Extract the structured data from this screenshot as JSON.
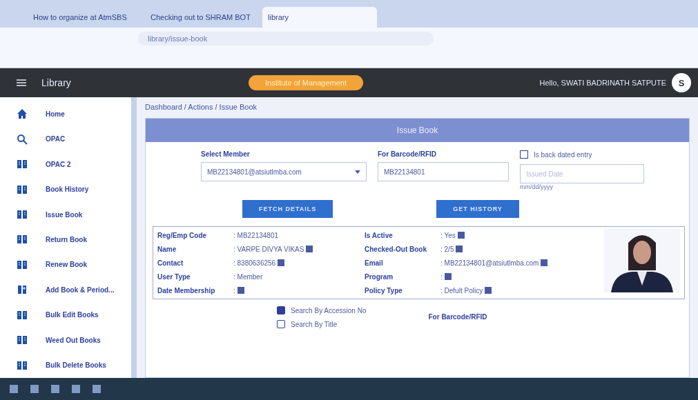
{
  "browser": {
    "tabs": [
      {
        "title": "How to organize at AtmSBS",
        "selected": false
      },
      {
        "title": "Checking out to SHRAM BOT",
        "selected": false
      },
      {
        "title": "library",
        "selected": true
      }
    ],
    "address": "library/issue-book"
  },
  "header": {
    "title": "Library",
    "pill": "Institute of Management",
    "greeting": "Hello, SWATI BADRINATH SATPUTE",
    "avatar": "S"
  },
  "sidebar": {
    "items": [
      {
        "label": "Home",
        "kind": "home"
      },
      {
        "label": "OPAC",
        "kind": "search"
      },
      {
        "label": "OPAC 2",
        "kind": "book"
      },
      {
        "label": "Book History",
        "kind": "book"
      },
      {
        "label": "Issue Book",
        "kind": "book"
      },
      {
        "label": "Return Book",
        "kind": "book"
      },
      {
        "label": "Renew Book",
        "kind": "book"
      },
      {
        "label": "Add Book & Period...",
        "kind": "add"
      },
      {
        "label": "Bulk Edit Books",
        "kind": "book"
      },
      {
        "label": "Weed Out Books",
        "kind": "book"
      },
      {
        "label": "Bulk Delete Books",
        "kind": "book"
      }
    ]
  },
  "breadcrumb": "Dashboard / Actions / Issue Book",
  "card": {
    "title": "Issue Book",
    "member": {
      "label": "Select Member",
      "value": "MB22134801@atsiutlmba.com"
    },
    "barcode": {
      "label": "For Barcode/RFID",
      "value": "MB22134801"
    },
    "back_dated": {
      "label": "Is back dated entry",
      "checked": false,
      "placeholder": "Issued Date",
      "hint": "mm/dd/yyyy"
    },
    "buttons": [
      "FETCH DETAILS",
      "GET HISTORY"
    ],
    "details_left": [
      {
        "label": "Reg/Emp Code",
        "value": ": MB22134801",
        "editable": false
      },
      {
        "label": "Name",
        "value": ": VARPE DIVYA VIKAS",
        "editable": true
      },
      {
        "label": "Contact",
        "value": ": 8380636256",
        "editable": true
      },
      {
        "label": "User Type",
        "value": ": Member",
        "editable": false
      },
      {
        "label": "Date Membership",
        "value": ":",
        "editable": true
      }
    ],
    "details_right": [
      {
        "label": "Is Active",
        "value": ": Yes",
        "editable": true
      },
      {
        "label": "Checked-Out Book",
        "value": ": 2/5",
        "editable": true
      },
      {
        "label": "Email",
        "value": ": MB22134801@atsiutlmba.com",
        "editable": true
      },
      {
        "label": "Program",
        "value": ":",
        "editable": true
      },
      {
        "label": "Policy Type",
        "value": ": Defult Policy",
        "editable": true
      }
    ],
    "search_modes": [
      {
        "label": "Search By Accession No",
        "selected": true
      },
      {
        "label": "Search By Title",
        "selected": false
      }
    ],
    "barcode2": {
      "label": "For Barcode/RFID"
    }
  }
}
